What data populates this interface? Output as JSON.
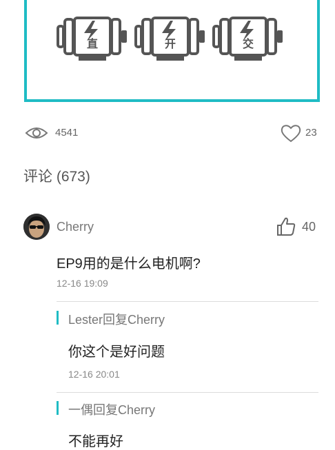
{
  "banner": {
    "motors": [
      {
        "icon": "dc-motor-icon",
        "char": "直"
      },
      {
        "icon": "switched-motor-icon",
        "char": "开"
      },
      {
        "icon": "ac-motor-icon",
        "char": "交"
      }
    ]
  },
  "stats": {
    "views": "4541",
    "likes": "23"
  },
  "comments": {
    "header": "评论 (673)",
    "items": [
      {
        "username": "Cherry",
        "likes": "40",
        "text": "EP9用的是什么电机啊?",
        "time": "12-16 19:09",
        "replies": [
          {
            "header": "Lester回复Cherry",
            "text": "你这个是好问题",
            "time": "12-16 20:01"
          },
          {
            "header": "一偶回复Cherry",
            "text": "不能再好",
            "time": ""
          }
        ]
      }
    ]
  },
  "colors": {
    "accent": "#1fbcc4",
    "icon": "#555555"
  }
}
